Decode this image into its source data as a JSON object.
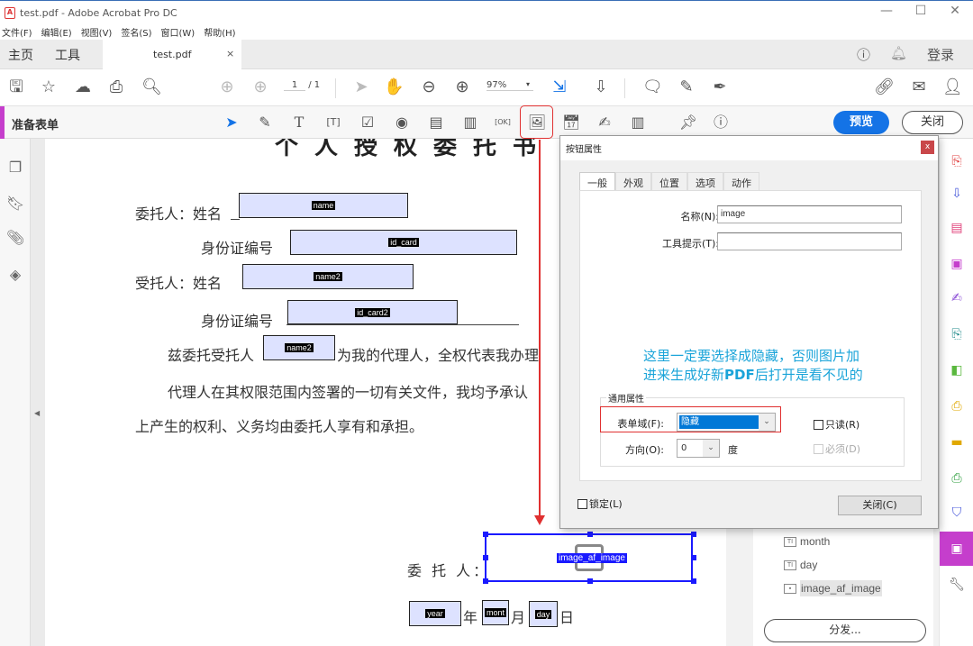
{
  "window": {
    "title": "test.pdf - Adobe Acrobat Pro DC",
    "minimize": "—",
    "maximize": "☐",
    "close": "✕"
  },
  "menu": [
    "文件(F)",
    "编辑(E)",
    "视图(V)",
    "签名(S)",
    "窗口(W)",
    "帮助(H)"
  ],
  "tabs": {
    "home": "主页",
    "tools": "工具",
    "document": "test.pdf",
    "document_close": "×",
    "login": "登录"
  },
  "toolbar": {
    "page_current": "1",
    "page_total": "/ 1",
    "zoom": "97%"
  },
  "formbar": {
    "title": "准备表单",
    "preview": "预览",
    "close": "关闭"
  },
  "document": {
    "title": "个人授权委托书",
    "principal_name_label": "委托人：姓名",
    "id_label_1": "身份证编号",
    "agent_name_label": "受托人：姓名",
    "id_label_2": "身份证编号",
    "para1_pre": "兹委托受托人",
    "para1_post": "为我的代理人，全权代表我办理",
    "para2": "代理人在其权限范围内签署的一切有关文件，我均予承认",
    "para3": "上产生的权利、义务均由委托人享有和承担。",
    "signer_label": "委 托 人：",
    "year_suffix": "年",
    "month_suffix": "月",
    "day_suffix": "日",
    "fields": {
      "name": "name",
      "id_card": "id_card",
      "name2": "name2",
      "id_card2": "id_card2",
      "name2_inline": "name2",
      "image": "image_af_image",
      "year": "year",
      "month": "mont",
      "day": "day"
    }
  },
  "dialog": {
    "title": "按钮属性",
    "close": "x",
    "tabs": [
      "一般",
      "外观",
      "位置",
      "选项",
      "动作"
    ],
    "active_tab": "一般",
    "name_label": "名称(N):",
    "name_value": "image",
    "tooltip_label": "工具提示(T):",
    "tooltip_value": "",
    "annotation_line1": "这里一定要选择成隐藏，否则图片加",
    "annotation_line2_pre": "进来生成好新",
    "annotation_line2_bold": "PDF",
    "annotation_line2_post": "后打开是看不见的",
    "group_title": "通用属性",
    "form_field_label": "表单域(F):",
    "form_field_value": "隐藏",
    "orientation_label": "方向(O):",
    "orientation_value": "0",
    "orientation_unit": "度",
    "readonly_label": "只读(R)",
    "required_label": "必须(D)",
    "locked_label": "锁定(L)",
    "close_button": "关闭(C)"
  },
  "fields_panel": {
    "items": [
      {
        "label": "month",
        "icon": "text-field-icon"
      },
      {
        "label": "day",
        "icon": "text-field-icon"
      },
      {
        "label": "image_af_image",
        "icon": "image-field-icon",
        "selected": true
      }
    ],
    "distribute": "分发..."
  },
  "colors": {
    "accent_purple": "#c53ecc",
    "acrobat_blue": "#1473e6",
    "annotation_red": "#e03030",
    "annotation_text": "#1aa4d9",
    "field_fill": "#dde2ff"
  }
}
